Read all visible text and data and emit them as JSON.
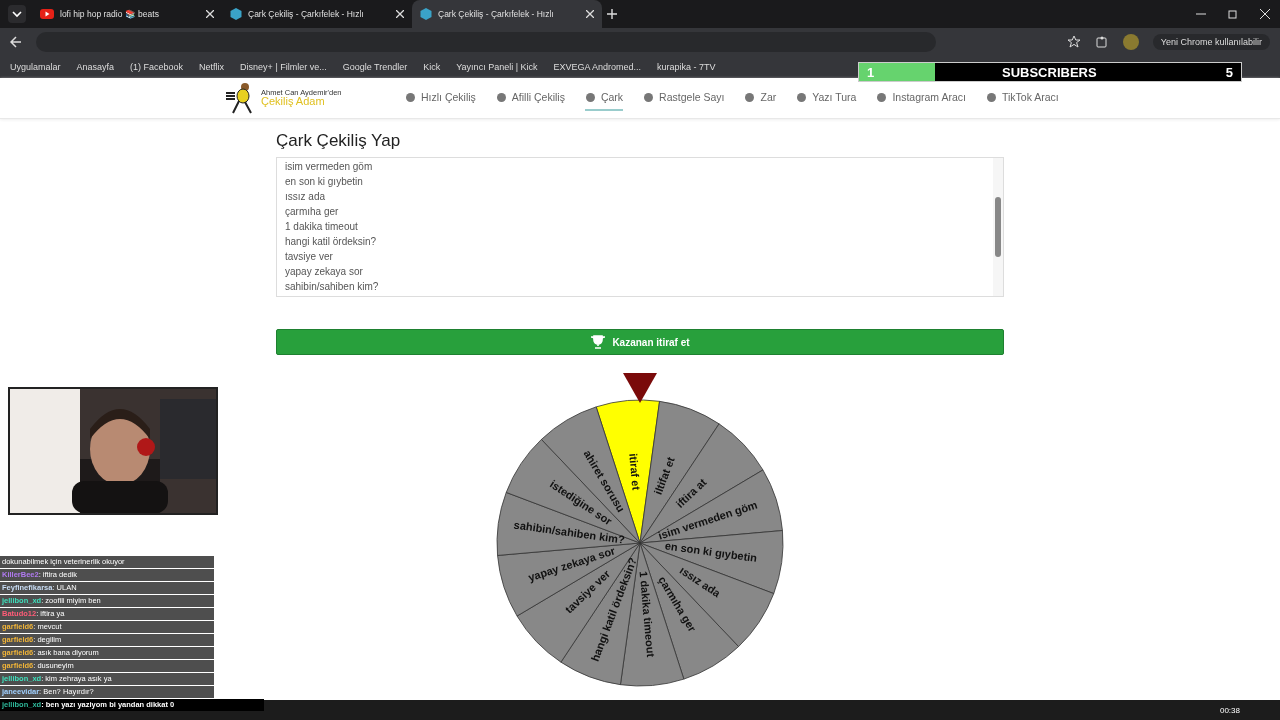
{
  "browser": {
    "tabs": [
      {
        "title": "lofi hip hop radio 📚 beats",
        "selected": false,
        "kind": "youtube"
      },
      {
        "title": "Çark Çekiliş - Çarkıfelek - Hızlı",
        "selected": false,
        "kind": "site"
      },
      {
        "title": "Çark Çekiliş - Çarkıfelek - Hızlı",
        "selected": true,
        "kind": "site"
      }
    ],
    "update_notice": "Yeni Chrome kullanılabilir",
    "bookmarks": [
      "Uygulamalar",
      "Anasayfa",
      "(1) Facebook",
      "Netflix",
      "Disney+ | Filmler ve...",
      "Google Trendler",
      "Kick",
      "Yayıncı Paneli | Kick",
      "EXVEGA Andromed...",
      "kurapika - 7TV"
    ]
  },
  "site": {
    "logo_top": "Ahmet Can Aydemir'den",
    "logo_name": "Çekiliş Adam",
    "nav": [
      {
        "label": "Hızlı Çekiliş",
        "selected": false
      },
      {
        "label": "Afilli Çekiliş",
        "selected": false
      },
      {
        "label": "Çark",
        "selected": true
      },
      {
        "label": "Rastgele Sayı",
        "selected": false
      },
      {
        "label": "Zar",
        "selected": false
      },
      {
        "label": "Yazı Tura",
        "selected": false
      },
      {
        "label": "Instagram Aracı",
        "selected": false
      },
      {
        "label": "TikTok Aracı",
        "selected": false
      }
    ]
  },
  "heading": "Çark Çekiliş Yap",
  "entries": [
    "isim vermeden göm",
    "en son ki gıybetin",
    "ıssız ada",
    "çarmıha ger",
    "1 dakika timeout",
    "hangi katil ördeksin?",
    "tavsiye ver",
    "yapay zekaya sor",
    "sahibin/sahiben kim?"
  ],
  "result_button": "Kazanan itiraf et",
  "wheel": [
    {
      "label": "itiraf et",
      "selected": true
    },
    {
      "label": "iltifat et",
      "selected": false
    },
    {
      "label": "iftira at",
      "selected": false
    },
    {
      "label": "isim vermeden göm",
      "selected": false
    },
    {
      "label": "en son ki gıybetin",
      "selected": false
    },
    {
      "label": "ıssız ada",
      "selected": false
    },
    {
      "label": "çarmıha ger",
      "selected": false
    },
    {
      "label": "1 dakika timeout",
      "selected": false
    },
    {
      "label": "hangi katil ördeksin?",
      "selected": false
    },
    {
      "label": "tavsiye ver",
      "selected": false
    },
    {
      "label": "yapay zekaya sor",
      "selected": false
    },
    {
      "label": "sahibin/sahiben kim?",
      "selected": false
    },
    {
      "label": "istediğine sor",
      "selected": false
    },
    {
      "label": "ahiret sorusu",
      "selected": false
    }
  ],
  "subscribers": {
    "current": "1",
    "label": "SUBSCRIBERS",
    "goal": "5",
    "level": 0.2
  },
  "webcam": {
    "kind": "picture"
  },
  "chat": [
    {
      "message": "dokunabilmek için veterinerlik okuyor"
    },
    {
      "user": "KillerBee2",
      "message": ": iftira dedik",
      "color": "#b07af0"
    },
    {
      "user": "Feyfinefikarsa",
      "message": ": ULAN",
      "color": "#c8dcf4"
    },
    {
      "user": "jellibon_xd",
      "message": ": zoofili miyim ben",
      "color": "#3ee0bc"
    },
    {
      "user": "Batudo12",
      "message": ": iftira ya",
      "color": "#ff5c78"
    },
    {
      "user": "garfield6",
      "message": ": mevcut",
      "color": "#f0b438"
    },
    {
      "user": "garfield6",
      "message": ": degilim",
      "color": "#f0b438"
    },
    {
      "user": "garfield6",
      "message": ": asık bana diyorum",
      "color": "#f0b438"
    },
    {
      "user": "garfield6",
      "message": ": dusuneyim",
      "color": "#f0b438"
    },
    {
      "user": "jellibon_xd",
      "message": ": kim zehraya asık ya",
      "color": "#3ee0bc"
    },
    {
      "user": "janeevidar",
      "message": ": Ben? Hayırdır?",
      "color": "#a0d0ff"
    }
  ],
  "chat_highlight": {
    "user": "jellibon_xd",
    "message": ": ben yazı yaziyom bi yandan dikkat 0",
    "color": "#2eb89a"
  },
  "clock": "00:38"
}
